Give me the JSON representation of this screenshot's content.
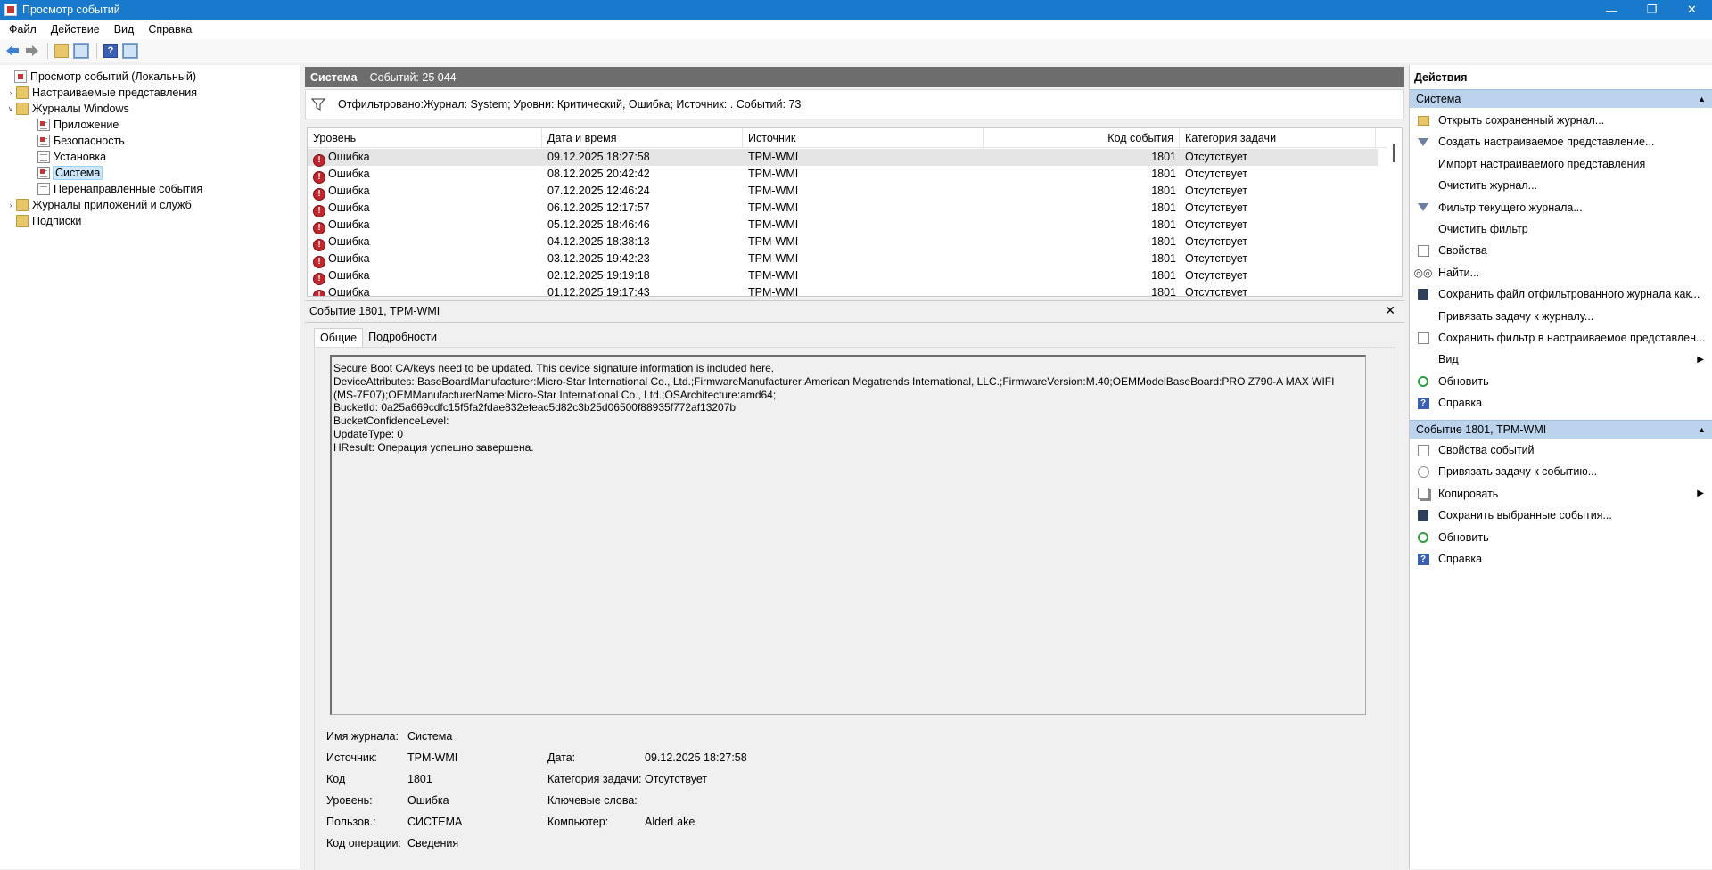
{
  "window": {
    "title": "Просмотр событий"
  },
  "menu": [
    "Файл",
    "Действие",
    "Вид",
    "Справка"
  ],
  "tree": {
    "root": "Просмотр событий (Локальный)",
    "custom_views": "Настраиваемые представления",
    "windows_logs": "Журналы Windows",
    "application": "Приложение",
    "security": "Безопасность",
    "setup": "Установка",
    "system": "Система",
    "forwarded": "Перенаправленные события",
    "apps_services": "Журналы приложений и служб",
    "subscriptions": "Подписки"
  },
  "center": {
    "header_title": "Система",
    "header_count": "Событий: 25 044",
    "filter_text": "Отфильтровано:Журнал: System; Уровни: Критический, Ошибка; Источник: . Событий: 73",
    "columns": [
      "Уровень",
      "Дата и время",
      "Источник",
      "Код события",
      "Категория задачи"
    ],
    "rows": [
      {
        "level": "Ошибка",
        "date": "09.12.2025 18:27:58",
        "source": "TPM-WMI",
        "code": "1801",
        "category": "Отсутствует"
      },
      {
        "level": "Ошибка",
        "date": "08.12.2025 20:42:42",
        "source": "TPM-WMI",
        "code": "1801",
        "category": "Отсутствует"
      },
      {
        "level": "Ошибка",
        "date": "07.12.2025 12:46:24",
        "source": "TPM-WMI",
        "code": "1801",
        "category": "Отсутствует"
      },
      {
        "level": "Ошибка",
        "date": "06.12.2025 12:17:57",
        "source": "TPM-WMI",
        "code": "1801",
        "category": "Отсутствует"
      },
      {
        "level": "Ошибка",
        "date": "05.12.2025 18:46:46",
        "source": "TPM-WMI",
        "code": "1801",
        "category": "Отсутствует"
      },
      {
        "level": "Ошибка",
        "date": "04.12.2025 18:38:13",
        "source": "TPM-WMI",
        "code": "1801",
        "category": "Отсутствует"
      },
      {
        "level": "Ошибка",
        "date": "03.12.2025 19:42:23",
        "source": "TPM-WMI",
        "code": "1801",
        "category": "Отсутствует"
      },
      {
        "level": "Ошибка",
        "date": "02.12.2025 19:19:18",
        "source": "TPM-WMI",
        "code": "1801",
        "category": "Отсутствует"
      },
      {
        "level": "Ошибка",
        "date": "01.12.2025 19:17:43",
        "source": "TPM-WMI",
        "code": "1801",
        "category": "Отсутствует"
      }
    ]
  },
  "detail": {
    "title": "Событие 1801, TPM-WMI",
    "tab_general": "Общие",
    "tab_details": "Подробности",
    "description": [
      "Secure Boot CA/keys need to be updated. This device signature information is included here.",
      "DeviceAttributes: BaseBoardManufacturer:Micro-Star International Co., Ltd.;FirmwareManufacturer:American Megatrends International, LLC.;FirmwareVersion:M.40;OEMModelBaseBoard:PRO Z790-A MAX WIFI",
      "(MS-7E07);OEMManufacturerName:Micro-Star International Co., Ltd.;OSArchitecture:amd64;",
      "BucketId: 0a25a669cdfc15f5fa2fdae832efeac5d82c3b25d06500f88935f772af13207b",
      "BucketConfidenceLevel:",
      "UpdateType: 0",
      "HResult: Операция успешно завершена."
    ],
    "fields": {
      "log_name_label": "Имя журнала:",
      "log_name": "Система",
      "source_label": "Источник:",
      "source": "TPM-WMI",
      "date_label": "Дата:",
      "date": "09.12.2025 18:27:58",
      "code_label": "Код",
      "code": "1801",
      "category_label": "Категория задачи:",
      "category": "Отсутствует",
      "level_label": "Уровень:",
      "level": "Ошибка",
      "keywords_label": "Ключевые слова:",
      "keywords": "",
      "user_label": "Пользов.:",
      "user": "СИСТЕМА",
      "computer_label": "Компьютер:",
      "computer": "AlderLake",
      "opcode_label": "Код операции:",
      "opcode": "Сведения"
    }
  },
  "actions": {
    "title": "Действия",
    "section1": "Система",
    "items1": [
      {
        "label": "Открыть сохраненный журнал...",
        "icon": "folder-open-icon"
      },
      {
        "label": "Создать настраиваемое представление...",
        "icon": "funnel-icon"
      },
      {
        "label": "Импорт настраиваемого представления",
        "icon": ""
      },
      {
        "label": "Очистить журнал...",
        "icon": ""
      },
      {
        "label": "Фильтр текущего журнала...",
        "icon": "funnel-icon"
      },
      {
        "label": "Очистить фильтр",
        "icon": ""
      },
      {
        "label": "Свойства",
        "icon": "properties-icon"
      },
      {
        "label": "Найти...",
        "icon": "binoculars-icon"
      },
      {
        "label": "Сохранить файл отфильтрованного журнала как...",
        "icon": "save-icon"
      },
      {
        "label": "Привязать задачу к журналу...",
        "icon": ""
      },
      {
        "label": "Сохранить фильтр в настраиваемое представлен...",
        "icon": "properties-icon"
      },
      {
        "label": "Вид",
        "icon": "",
        "submenu": true
      },
      {
        "label": "Обновить",
        "icon": "refresh-icon"
      },
      {
        "label": "Справка",
        "icon": "help-icon"
      }
    ],
    "section2": "Событие 1801, TPM-WMI",
    "items2": [
      {
        "label": "Свойства событий",
        "icon": "properties-icon"
      },
      {
        "label": "Привязать задачу к событию...",
        "icon": "task-icon"
      },
      {
        "label": "Копировать",
        "icon": "copy-icon",
        "submenu": true
      },
      {
        "label": "Сохранить выбранные события...",
        "icon": "save-icon"
      },
      {
        "label": "Обновить",
        "icon": "refresh-icon"
      },
      {
        "label": "Справка",
        "icon": "help-icon"
      }
    ]
  }
}
